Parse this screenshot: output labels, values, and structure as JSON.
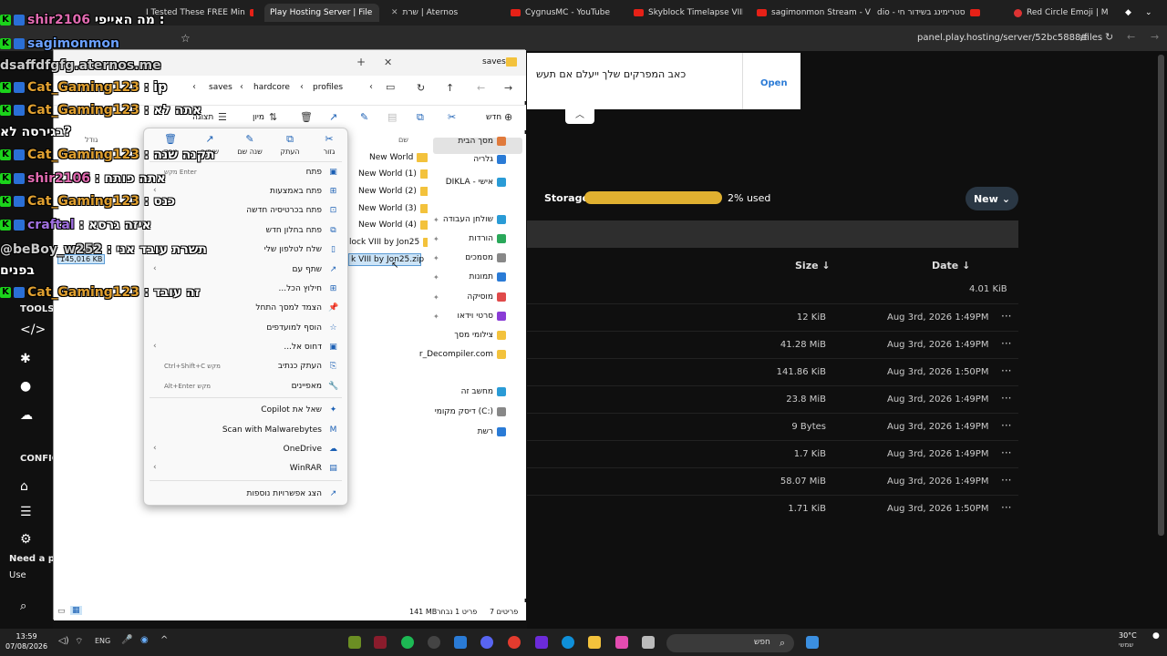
{
  "browser": {
    "tabs": [
      {
        "label": "I Tested These FREE Min",
        "active": false
      },
      {
        "label": "Play Hosting Server | File",
        "active": true
      },
      {
        "label": "שרת | Aternos",
        "active": false
      },
      {
        "label": "CygnusMC - YouTube",
        "active": false
      },
      {
        "label": "Skyblock Timelapse VIII",
        "active": false
      },
      {
        "label": "sagimonmon Stream - Vi",
        "active": false
      },
      {
        "label": "dio - סטרימינג בשידור חי",
        "active": false
      },
      {
        "label": "Red Circle Emoji | M",
        "active": false
      }
    ],
    "url": "panel.play.hosting/server/52bc5888/files"
  },
  "webpage": {
    "notification": {
      "text": "כאב המפרקים שלך ייעלם אם תעש",
      "open_label": "Open"
    },
    "storage_label": "Storage",
    "storage_used": "2% used",
    "storage_fraction": 0.02,
    "new_button": "New",
    "columns": {
      "size": "Size ↓",
      "date": "Date ↓"
    },
    "top_size": "4.01 KiB",
    "rows": [
      {
        "size": "12 KiB",
        "date": "Aug 3rd, 2026 1:49PM"
      },
      {
        "size": "41.28 MiB",
        "date": "Aug 3rd, 2026 1:49PM"
      },
      {
        "size": "141.86 KiB",
        "date": "Aug 3rd, 2026 1:50PM"
      },
      {
        "size": "23.8 MiB",
        "date": "Aug 3rd, 2026 1:49PM"
      },
      {
        "size": "9 Bytes",
        "date": "Aug 3rd, 2026 1:49PM"
      },
      {
        "size": "1.7 KiB",
        "date": "Aug 3rd, 2026 1:49PM"
      },
      {
        "size": "58.07 MiB",
        "date": "Aug 3rd, 2026 1:49PM"
      },
      {
        "size": "1.71 KiB",
        "date": "Aug 3rd, 2026 1:50PM"
      }
    ],
    "more_glyph": "···",
    "nav": {
      "tools": "TOOLS",
      "config": "CONFIG",
      "need": "Need a p",
      "use": "Use"
    }
  },
  "chat": [
    {
      "name": "shir2106",
      "msg": "מה האייפי :",
      "color": "pink"
    },
    {
      "name": "sagimonmon",
      "msg": "",
      "color": "blue"
    },
    {
      "name": "dsaffdfgfg.aternos.me",
      "msg": "",
      "color": "gray"
    },
    {
      "name": "Cat_Gaming123",
      "msg": ": ip",
      "color": "orange"
    },
    {
      "name": "Cat_Gaming123",
      "msg": ": אתה לא",
      "color": "orange"
    },
    {
      "name": "",
      "msg": "בגירסה לא?",
      "color": "gray"
    },
    {
      "name": "Cat_Gaming123",
      "msg": ": תקנה שנה",
      "color": "orange"
    },
    {
      "name": "shir2106",
      "msg": ": אתה פותח",
      "color": "pink"
    },
    {
      "name": "Cat_Gaming123",
      "msg": ": כנס",
      "color": "orange"
    },
    {
      "name": "craftal",
      "msg": ": איזה גרסא",
      "color": "purple"
    },
    {
      "name": "@beBoy_w252",
      "msg": ": תשרת עובד אני",
      "color": "gray"
    },
    {
      "name": "",
      "msg": "בפנים",
      "color": "gray"
    },
    {
      "name": "Cat_Gaming123",
      "msg": ": זה עובד",
      "color": "orange"
    }
  ],
  "explorer": {
    "tab_label": "saves",
    "breadcrumb": [
      "profiles",
      "hardcore",
      "saves"
    ],
    "new_label": "חדש",
    "sort_label": "מיון",
    "view_label": "תצוגה",
    "header_name": "שם",
    "header_size": "גודל",
    "files": [
      {
        "name": "New World",
        "type": "folder"
      },
      {
        "name": "New World (1)",
        "type": "folder"
      },
      {
        "name": "New World (2)",
        "type": "folder"
      },
      {
        "name": "New World (3)",
        "type": "folder"
      },
      {
        "name": "New World (4)",
        "type": "folder"
      },
      {
        "name": "lock VIII by Jon25",
        "type": "folder"
      },
      {
        "name": "k VIII by Jon25.zip",
        "type": "zip"
      }
    ],
    "selected_size": "145,016 KB",
    "sidebar": [
      {
        "label": "מסך הבית",
        "pin": false
      },
      {
        "label": "גלריה",
        "pin": false
      },
      {
        "label": "DIKLA - אישי",
        "pin": false
      },
      {
        "label": "שולחן העבודה",
        "pin": true
      },
      {
        "label": "הורדות",
        "pin": true
      },
      {
        "label": "מסמכים",
        "pin": true
      },
      {
        "label": "תמונות",
        "pin": true
      },
      {
        "label": "מוסיקה",
        "pin": true
      },
      {
        "label": "סרטי וידאו",
        "pin": true
      },
      {
        "label": "צילומי מסך",
        "pin": false
      },
      {
        "label": "r_Decompiler.com",
        "pin": false
      },
      {
        "label": "מחשב זה",
        "pin": false
      },
      {
        "label": "דיסק מקומי (C:)",
        "pin": false
      },
      {
        "label": "רשת",
        "pin": false
      }
    ],
    "status_items": "7 פריטים",
    "status_selected": "פריט 1 נבחר",
    "status_size": "141 MB"
  },
  "context_menu": {
    "quick_actions": [
      {
        "label": "גזור",
        "icon": "✂"
      },
      {
        "label": "העתק",
        "icon": "⧉"
      },
      {
        "label": "שנה שם",
        "icon": "✎"
      },
      {
        "label": "שיתוף",
        "icon": "↗"
      },
      {
        "label": "מחק",
        "icon": "🗑"
      }
    ],
    "items": [
      {
        "label": "פתח",
        "shortcut": "מקש Enter",
        "submenu": false
      },
      {
        "label": "פתח באמצעות",
        "shortcut": "",
        "submenu": true
      },
      {
        "label": "פתח בכרטיסיה חדשה",
        "shortcut": "",
        "submenu": false
      },
      {
        "label": "פתח בחלון חדש",
        "shortcut": "",
        "submenu": false
      },
      {
        "label": "שלח לטלפון שלי",
        "shortcut": "",
        "submenu": false
      },
      {
        "label": "שתף עם",
        "shortcut": "",
        "submenu": true
      },
      {
        "label": "חילוץ הכל...",
        "shortcut": "",
        "submenu": false
      },
      {
        "label": "הצמד למסך התחל",
        "shortcut": "",
        "submenu": false
      },
      {
        "label": "הוסף למועדפים",
        "shortcut": "",
        "submenu": false
      },
      {
        "label": "דחוס אל...",
        "shortcut": "",
        "submenu": true
      },
      {
        "label": "העתק כנתיב",
        "shortcut": "Ctrl+Shift+C מקש",
        "submenu": false
      },
      {
        "label": "מאפיינים",
        "shortcut": "Alt+Enter מקש",
        "submenu": false
      },
      {
        "label": "שאל את Copilot",
        "shortcut": "",
        "submenu": false
      },
      {
        "label": "Scan with Malwarebytes",
        "shortcut": "",
        "submenu": false
      },
      {
        "label": "OneDrive",
        "shortcut": "",
        "submenu": true
      },
      {
        "label": "WinRAR",
        "shortcut": "",
        "submenu": true
      },
      {
        "label": "הצג אפשרויות נוספות",
        "shortcut": "",
        "submenu": false
      }
    ]
  },
  "taskbar": {
    "time": "13:59",
    "date": "07/08/2026",
    "lang": "ENG",
    "search": "חפש",
    "temp": "30°C",
    "weather": "שמשי"
  }
}
